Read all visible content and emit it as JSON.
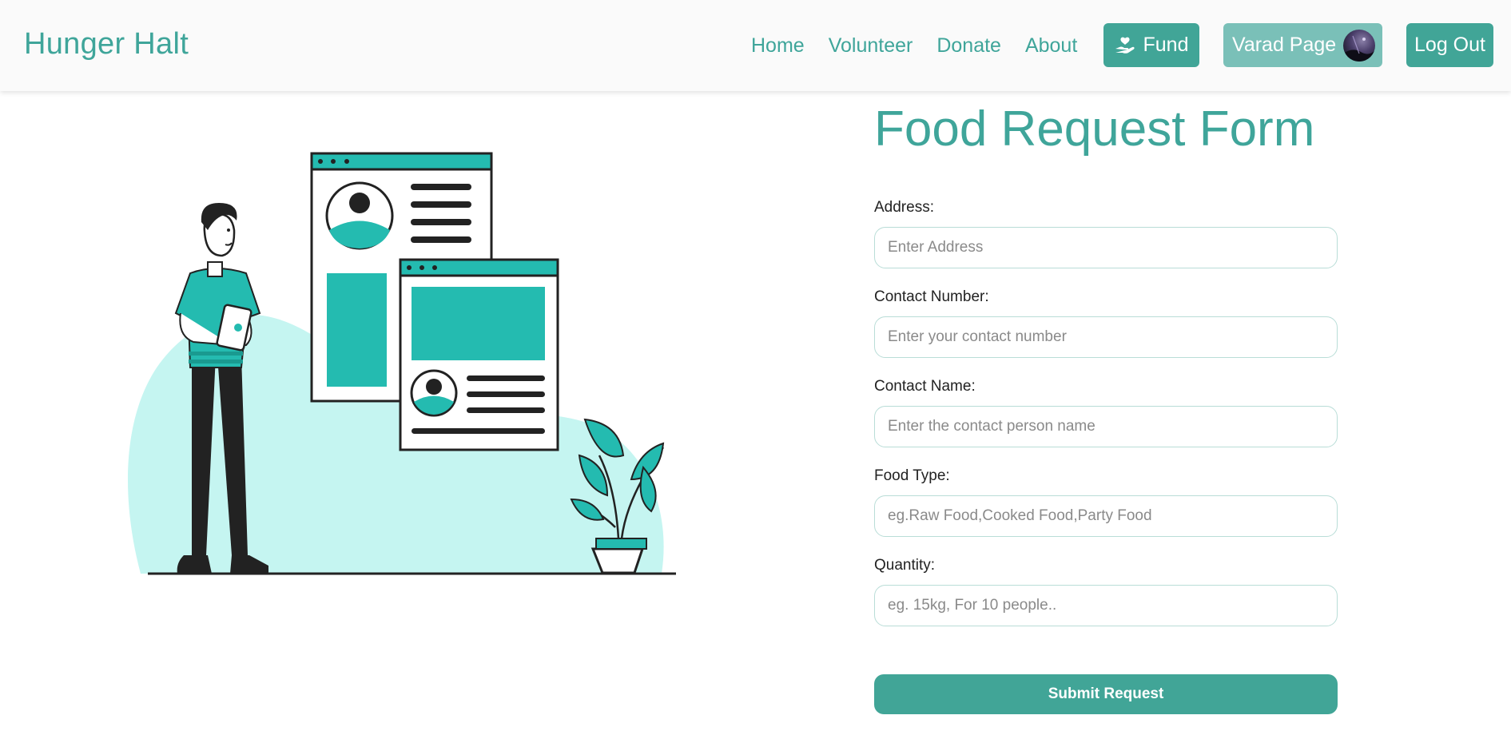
{
  "navbar": {
    "brand": "Hunger Halt",
    "links": [
      "Home",
      "Volunteer",
      "Donate",
      "About"
    ],
    "fund_label": "Fund",
    "profile_label": "Varad Page",
    "logout_label": "Log Out"
  },
  "form": {
    "title": "Food Request Form",
    "fields": [
      {
        "label": "Address:",
        "placeholder": "Enter Address",
        "value": ""
      },
      {
        "label": "Contact Number:",
        "placeholder": "Enter your contact number",
        "value": ""
      },
      {
        "label": "Contact Name:",
        "placeholder": "Enter the contact person name",
        "value": ""
      },
      {
        "label": "Food Type:",
        "placeholder": "eg.Raw Food,Cooked Food,Party Food",
        "value": ""
      },
      {
        "label": "Quantity:",
        "placeholder": "eg. 15kg, For 10 people..",
        "value": ""
      }
    ],
    "submit_label": "Submit Request"
  },
  "colors": {
    "accent": "#41a597",
    "accent_light": "#7ac0b8",
    "illustration_teal": "#24bbb0",
    "illustration_bg": "#c5f5f1"
  },
  "icons": [
    "hand-heart-icon",
    "avatar"
  ]
}
